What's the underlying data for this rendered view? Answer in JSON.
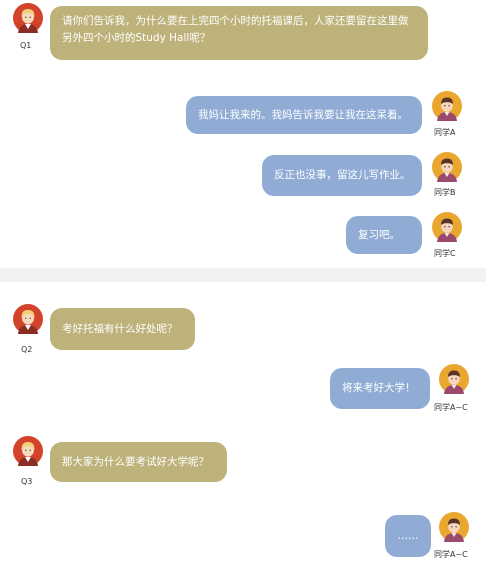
{
  "colors": {
    "question_bubble": "#beb27b",
    "answer_bubble": "#90acd5",
    "separator": "#f2f2f2",
    "avatar_background_left": "#d3432b",
    "avatar_background_right": "#e9a72f"
  },
  "messages": [
    {
      "side": "left",
      "speaker": "Q1",
      "avatar_icon": "teacher-avatar-icon",
      "text": "请你们告诉我，为什么要在上完四个小时的托福课后，人家还要留在这里做另外四个小时的Study Hall呢？"
    },
    {
      "side": "right",
      "speaker": "同学A",
      "avatar_icon": "student-avatar-icon",
      "text": "我妈让我来的。我妈告诉我要让我在这呆着。"
    },
    {
      "side": "right",
      "speaker": "同学B",
      "avatar_icon": "student-avatar-icon",
      "text": "反正也没事，留这儿写作业。"
    },
    {
      "side": "right",
      "speaker": "同学C",
      "avatar_icon": "student-avatar-icon",
      "text": "复习吧。"
    },
    {
      "side": "left",
      "speaker": "Q2",
      "avatar_icon": "teacher-avatar-icon",
      "text": "考好托福有什么好处呢？"
    },
    {
      "side": "right",
      "speaker": "同学A~C",
      "avatar_icon": "student-avatar-icon",
      "text": "将来考好大学！"
    },
    {
      "side": "left",
      "speaker": "Q3",
      "avatar_icon": "teacher-avatar-icon",
      "text": "那大家为什么要考试好大学呢？"
    },
    {
      "side": "right",
      "speaker": "同学A~C",
      "avatar_icon": "student-avatar-icon",
      "text": "……"
    }
  ]
}
